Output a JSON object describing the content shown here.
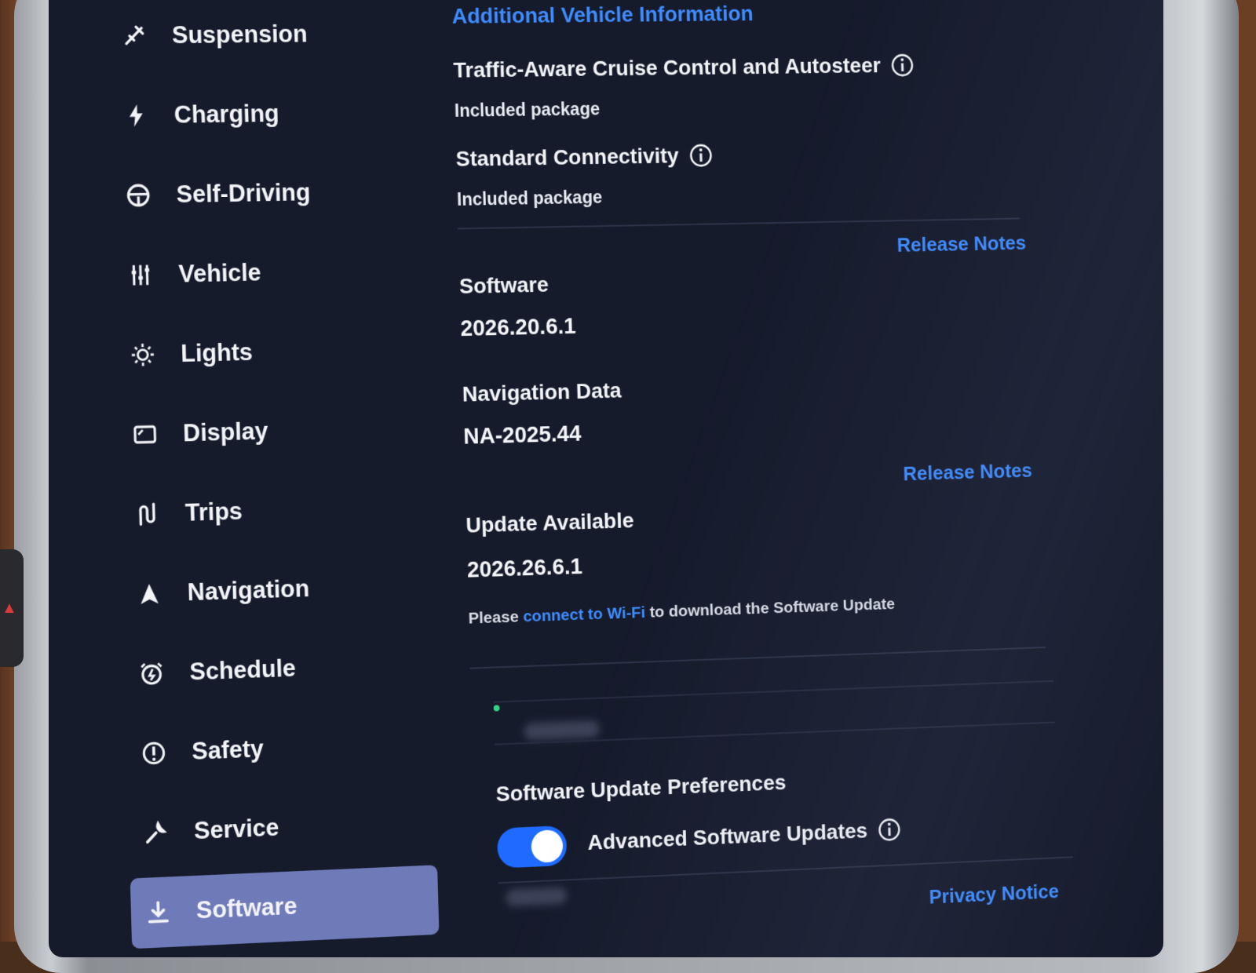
{
  "sidebar": {
    "items": [
      {
        "label": "Suspension",
        "icon": "suspension-icon"
      },
      {
        "label": "Charging",
        "icon": "lightning-icon"
      },
      {
        "label": "Self-Driving",
        "icon": "steering-wheel-icon"
      },
      {
        "label": "Vehicle",
        "icon": "sliders-icon"
      },
      {
        "label": "Lights",
        "icon": "sun-icon"
      },
      {
        "label": "Display",
        "icon": "display-icon"
      },
      {
        "label": "Trips",
        "icon": "route-icon"
      },
      {
        "label": "Navigation",
        "icon": "navigation-arrow-icon"
      },
      {
        "label": "Schedule",
        "icon": "alarm-clock-icon"
      },
      {
        "label": "Safety",
        "icon": "exclamation-circle-icon"
      },
      {
        "label": "Service",
        "icon": "wrench-icon"
      },
      {
        "label": "Software",
        "icon": "download-icon",
        "active": true
      }
    ]
  },
  "main": {
    "additional_info_title": "Additional Vehicle Information",
    "packages": [
      {
        "title": "Traffic-Aware Cruise Control and Autosteer",
        "status": "Included package"
      },
      {
        "title": "Standard Connectivity",
        "status": "Included package"
      }
    ],
    "software": {
      "label": "Software",
      "version": "2026.20.6.1",
      "release_notes": "Release Notes"
    },
    "navigation_data": {
      "label": "Navigation Data",
      "version": "NA-2025.44"
    },
    "update": {
      "label": "Update Available",
      "version": "2026.26.6.1",
      "release_notes": "Release Notes",
      "note_prefix": "Please ",
      "note_link": "connect to Wi-Fi",
      "note_suffix": " to download the Software Update"
    },
    "preferences": {
      "title": "Software Update Preferences",
      "advanced_label": "Advanced Software Updates",
      "advanced_enabled": true
    },
    "privacy_notice": "Privacy Notice"
  },
  "colors": {
    "background": "#161b2c",
    "accent": "#3f8cff",
    "active_item": "#6f7ab8",
    "toggle_on": "#1f6bff"
  }
}
